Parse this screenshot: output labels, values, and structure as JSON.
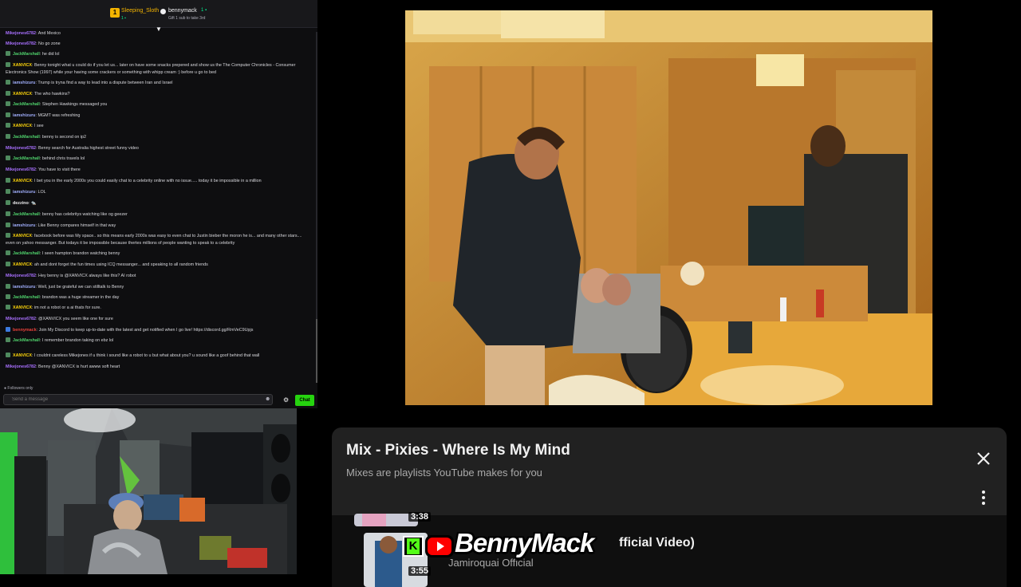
{
  "chat": {
    "header": {
      "gifter_left_name": "Sleeping_Sloth",
      "gifter_left_meta": "1 ▪",
      "gifter_left_badge": "1",
      "gifter_right_name": "bennymack",
      "gifter_right_meta": "Gift 1 sub to take 3rd",
      "gifter_right_count": "1 ▪"
    },
    "messages": [
      {
        "user": "Mikejones6782",
        "color": "purple",
        "text": ": And Mexico",
        "badge": false
      },
      {
        "user": "Mikejones6782",
        "color": "purple",
        "text": ": No go zone",
        "badge": false
      },
      {
        "user": "JackMarshall",
        "color": "green",
        "text": ": he did lol",
        "badge": true
      },
      {
        "user": "XANVICX",
        "color": "yellow",
        "text": ": Benny tonight what u could do if you let us... later on have some snacks prepered and show us the The Computer Chronicles - Consumer Electronics Show (1997) while your having some crackers or something with whipp cream :) before u go to bed",
        "badge": true
      },
      {
        "user": "iamshizuru",
        "color": "blue",
        "text": ": Trump is tryna find a way to lead into a dispute between Iran and Israel",
        "badge": true
      },
      {
        "user": "XANVICX",
        "color": "yellow",
        "text": ": The who hawkins?",
        "badge": true
      },
      {
        "user": "JackMarshall",
        "color": "green",
        "text": ": Stephen Hawkings messaged you",
        "badge": true
      },
      {
        "user": "iamshizuru",
        "color": "blue",
        "text": ": MGMT was refreshing",
        "badge": true
      },
      {
        "user": "XANVICX",
        "color": "yellow",
        "text": ": I see",
        "badge": true
      },
      {
        "user": "JackMarshall",
        "color": "green",
        "text": ": benny is second on ip2",
        "badge": true
      },
      {
        "user": "Mikejones6782",
        "color": "purple",
        "text": ": Benny search for Australia highest street funny video",
        "badge": false
      },
      {
        "user": "JackMarshall",
        "color": "green",
        "text": ": behind chris travels lol",
        "badge": true
      },
      {
        "user": "Mikejones6782",
        "color": "purple",
        "text": ": You have to visit there",
        "badge": false
      },
      {
        "user": "XANVICX",
        "color": "yellow",
        "text": ": I bet you in the early 2000s you could easily chat to a celebrity online with no issue..... today it be impossible in a million",
        "badge": true
      },
      {
        "user": "iamshizuru",
        "color": "blue",
        "text": ": LOL",
        "badge": true
      },
      {
        "user": "dezzino",
        "color": "white",
        "text": ": 🐀",
        "badge": true
      },
      {
        "user": "JackMarshall",
        "color": "green",
        "text": ": benny has celebritys watching like og geezer",
        "badge": true
      },
      {
        "user": "iamshizuru",
        "color": "blue",
        "text": ": Like Benny compares himself in that way",
        "badge": true
      },
      {
        "user": "XANVICX",
        "color": "yellow",
        "text": ": facebook before was My space.. so this means early 2000s was easy to even chat to Justin bieber the moron he is... and many other stars.... even on yahoo messanger. But todays it be impossible because thertes millions of people wanting to speak to a celebrity",
        "badge": true
      },
      {
        "user": "JackMarshall",
        "color": "green",
        "text": ": I seen hampton brandon watching benny",
        "badge": true
      },
      {
        "user": "XANVICX",
        "color": "yellow",
        "text": ": ah and dont forget the fun times using ICQ messanger... and speaking to all random friends",
        "badge": true
      },
      {
        "user": "Mikejones6782",
        "color": "purple",
        "text": ": Hey benny is @XANVICX always like this? AI robot",
        "badge": false
      },
      {
        "user": "iamshizuru",
        "color": "blue",
        "text": ": Well, just be grateful we can stilltalk to Benny",
        "badge": true
      },
      {
        "user": "JackMarshall",
        "color": "green",
        "text": ": brandon was a huge streamer in the day",
        "badge": true
      },
      {
        "user": "XANVICX",
        "color": "yellow",
        "text": ": im not a robot or a ai thats for sure.",
        "badge": true
      },
      {
        "user": "Mikejones6782",
        "color": "purple",
        "text": ": @XANVICX you seem like one for sure",
        "badge": false
      },
      {
        "user": "bennymack",
        "color": "red",
        "text": ": Join My Discord to keep up-to-date with the latest and get notified when I go live! https://discord.gg/RmVeC9Upjs",
        "badge": true
      },
      {
        "user": "JackMarshall",
        "color": "green",
        "text": ": I remember brandon taking on ebz lol",
        "badge": true
      },
      {
        "user": "XANVICX",
        "color": "yellow",
        "text": ": I couldnt careless Mikejones if u think i sound like a robot to u but what about you? u sound like a goof behind that wall",
        "badge": true
      },
      {
        "user": "Mikejones6782",
        "color": "purple",
        "text": ": Benny @XANVICX is hurt awww soft heart",
        "badge": false
      }
    ],
    "followers_only": "Followers only",
    "input_placeholder": "Send a message",
    "chat_button": "Chat"
  },
  "mix": {
    "title": "Mix - Pixies - Where Is My Mind",
    "subtitle": "Mixes are playlists YouTube makes for you",
    "tracks": [
      {
        "duration": "3:38"
      },
      {
        "duration": "3:55",
        "title": "fficial Video)",
        "channel": "Jamiroquai Official"
      }
    ]
  },
  "overlay": {
    "brand": "BennyMack",
    "kick_letter": "K"
  },
  "colors": {
    "chat_bg": "#0e0e10",
    "chat_button": "#26d30f",
    "mix_card": "#212121",
    "youtube_red": "#ff0000",
    "kick_green": "#53fc18"
  },
  "icons": [
    "collapse-arrow-icon",
    "settings-icon",
    "emote-icon",
    "close-icon",
    "more-vert-icon",
    "kick-icon",
    "youtube-icon"
  ]
}
